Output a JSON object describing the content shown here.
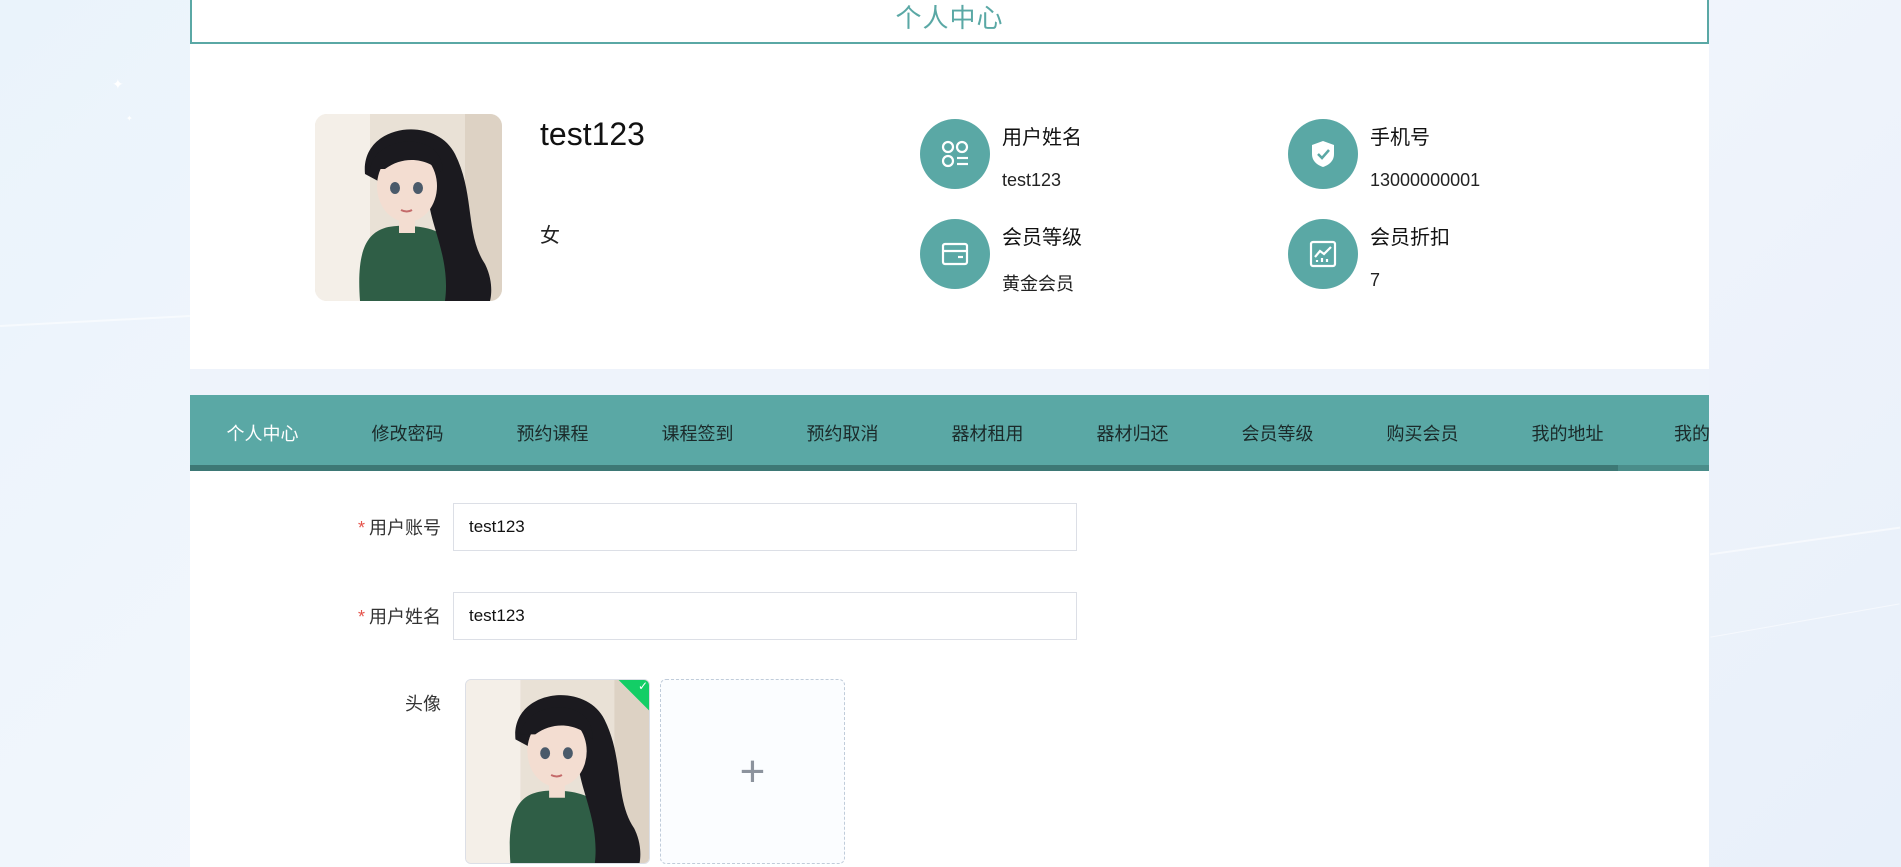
{
  "page": {
    "title": "个人中心"
  },
  "profile": {
    "username": "test123",
    "gender": "女",
    "stats": [
      {
        "label": "用户姓名",
        "value": "test123",
        "icon": "apps-icon"
      },
      {
        "label": "手机号",
        "value": "13000000001",
        "icon": "shield-check-icon"
      },
      {
        "label": "会员等级",
        "value": "黄金会员",
        "icon": "card-icon"
      },
      {
        "label": "会员折扣",
        "value": "7",
        "icon": "chart-icon"
      }
    ]
  },
  "tabs": [
    {
      "label": "个人中心",
      "active": true
    },
    {
      "label": "修改密码"
    },
    {
      "label": "预约课程"
    },
    {
      "label": "课程签到"
    },
    {
      "label": "预约取消"
    },
    {
      "label": "器材租用"
    },
    {
      "label": "器材归还"
    },
    {
      "label": "会员等级"
    },
    {
      "label": "购买会员"
    },
    {
      "label": "我的地址"
    },
    {
      "label": "我的"
    }
  ],
  "tabs_scroll_progress": 0.94,
  "form": {
    "account": {
      "label": "用户账号",
      "value": "test123",
      "required": true
    },
    "name": {
      "label": "用户姓名",
      "value": "test123",
      "required": true
    },
    "avatar": {
      "label": "头像",
      "upload_icon": "plus-icon"
    }
  },
  "colors": {
    "accent": "#5aa8a5",
    "success": "#13ce66",
    "required": "#e5534b"
  }
}
